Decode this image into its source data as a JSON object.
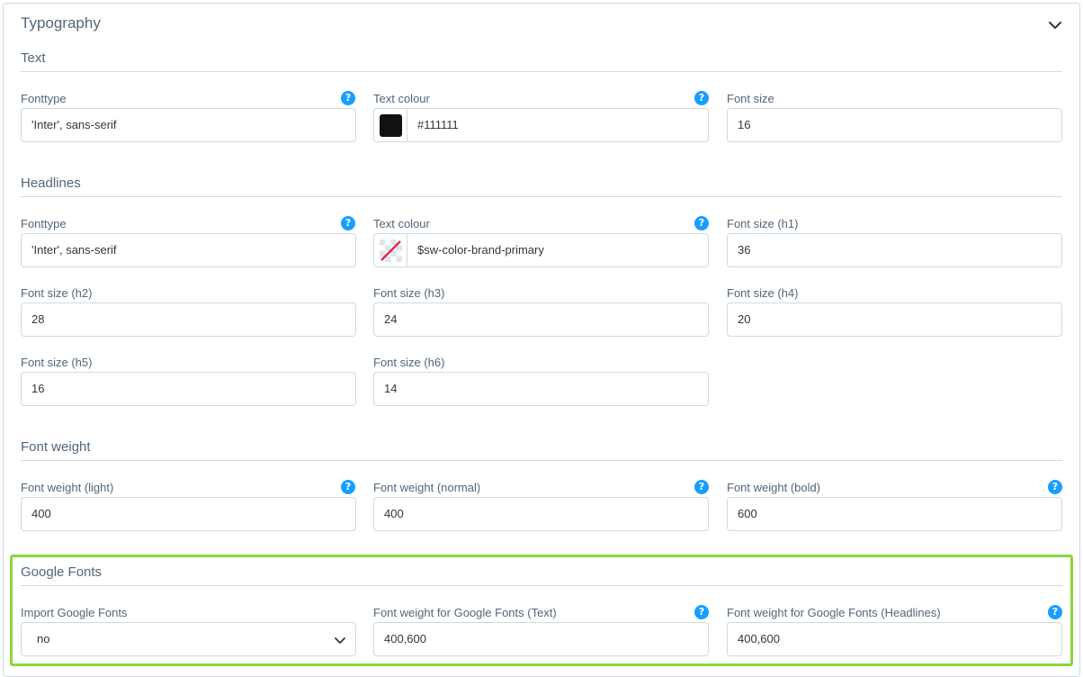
{
  "card": {
    "title": "Typography"
  },
  "sections": {
    "text": {
      "title": "Text",
      "fonttype": {
        "label": "Fonttype",
        "value": "'Inter', sans-serif"
      },
      "colour": {
        "label": "Text colour",
        "value": "#111111",
        "swatch": "#111111"
      },
      "size": {
        "label": "Font size",
        "value": "16"
      }
    },
    "headlines": {
      "title": "Headlines",
      "fonttype": {
        "label": "Fonttype",
        "value": "'Inter', sans-serif"
      },
      "colour": {
        "label": "Text colour",
        "value": "$sw-color-brand-primary"
      },
      "h1": {
        "label": "Font size (h1)",
        "value": "36"
      },
      "h2": {
        "label": "Font size (h2)",
        "value": "28"
      },
      "h3": {
        "label": "Font size (h3)",
        "value": "24"
      },
      "h4": {
        "label": "Font size (h4)",
        "value": "20"
      },
      "h5": {
        "label": "Font size (h5)",
        "value": "16"
      },
      "h6": {
        "label": "Font size (h6)",
        "value": "14"
      }
    },
    "weight": {
      "title": "Font weight",
      "light": {
        "label": "Font weight (light)",
        "value": "400"
      },
      "normal": {
        "label": "Font weight (normal)",
        "value": "400"
      },
      "bold": {
        "label": "Font weight (bold)",
        "value": "600"
      }
    },
    "google": {
      "title": "Google Fonts",
      "import": {
        "label": "Import Google Fonts",
        "value": "no"
      },
      "text_weight": {
        "label": "Font weight for Google Fonts (Text)",
        "value": "400,600"
      },
      "headline_weight": {
        "label": "Font weight for Google Fonts (Headlines)",
        "value": "400,600"
      }
    }
  },
  "help_glyph": "?",
  "colors": {
    "accent": "#189eff",
    "highlight": "#8ed53c",
    "border": "#d1d9e0"
  }
}
